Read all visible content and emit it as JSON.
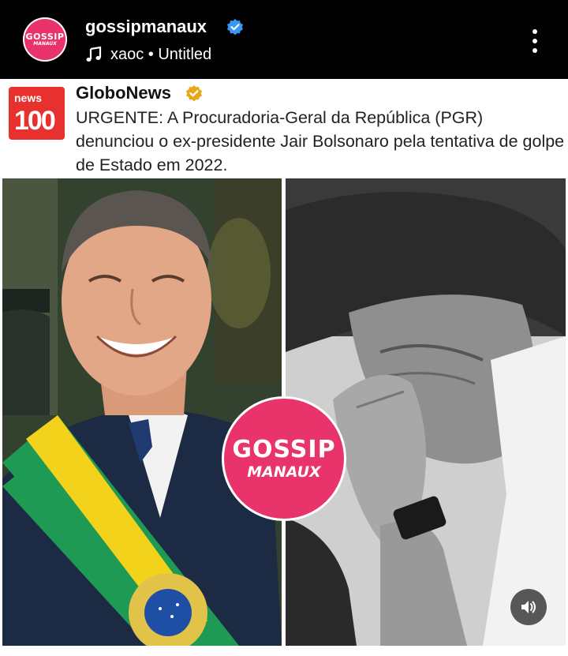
{
  "header": {
    "avatar": {
      "line1": "GOSSIP",
      "line2": "MANAUX"
    },
    "username": "gossipmanaux",
    "audio": "xaoc • Untitled",
    "icons": {
      "verified": "verified-badge-icon",
      "music": "music-note-icon",
      "more": "more-options-icon"
    }
  },
  "post": {
    "account_logo": {
      "line1": "news",
      "line2": "100"
    },
    "account_name": "GloboNews",
    "account_badge_color": "#e6a817",
    "text": "URGENTE: A Procuradoria-Geral da República (PGR) denunciou o ex-presidente Jair Bolsonaro pela tentativa de golpe de Estado em 2022.",
    "watermark": {
      "line1": "GOSSIP",
      "line2": "MANAUX"
    }
  },
  "controls": {
    "sound": "speaker-icon"
  },
  "colors": {
    "brand_pink": "#e8336b",
    "globo_red": "#e8312f",
    "verified_blue": "#3897f0"
  }
}
